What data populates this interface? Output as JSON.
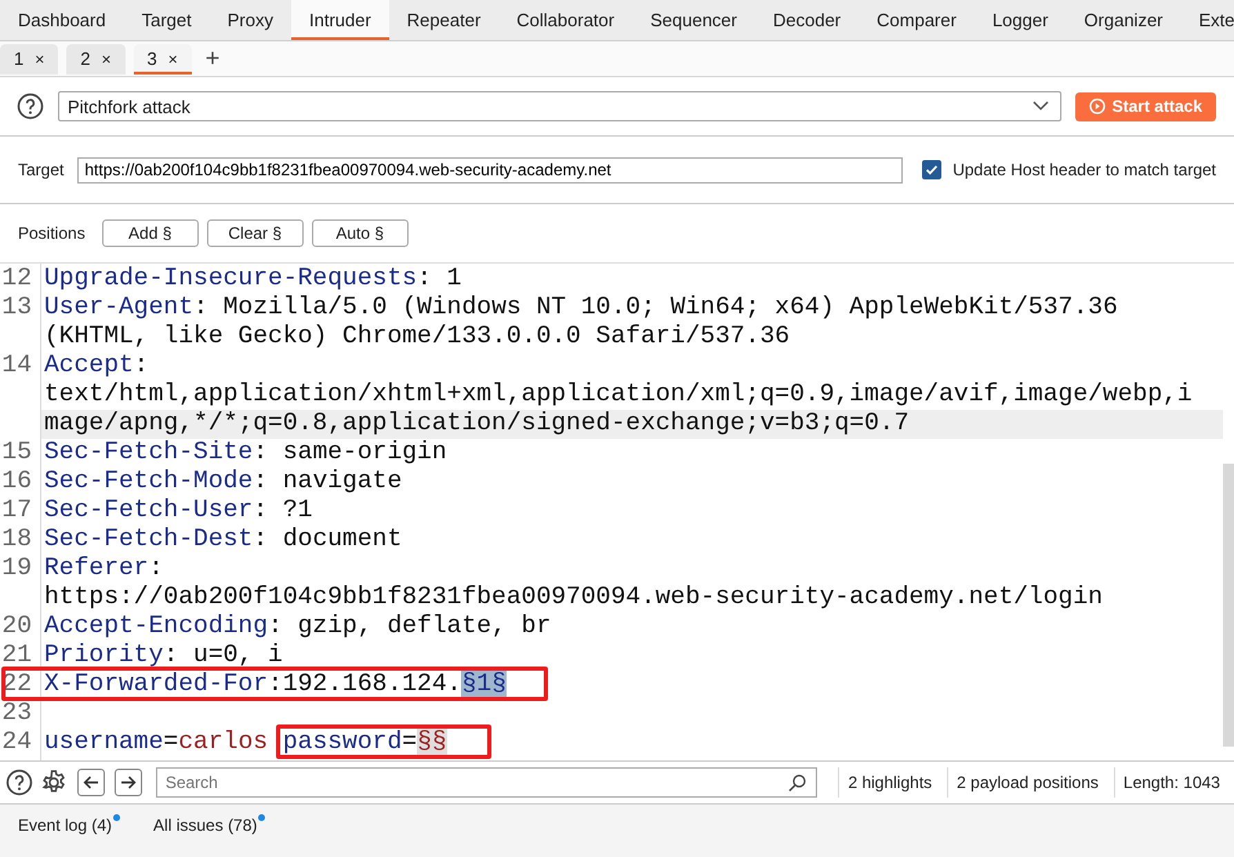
{
  "top_tabs": [
    {
      "label": "Dashboard",
      "selected": false
    },
    {
      "label": "Target",
      "selected": false
    },
    {
      "label": "Proxy",
      "selected": false
    },
    {
      "label": "Intruder",
      "selected": true
    },
    {
      "label": "Repeater",
      "selected": false
    },
    {
      "label": "Collaborator",
      "selected": false
    },
    {
      "label": "Sequencer",
      "selected": false
    },
    {
      "label": "Decoder",
      "selected": false
    },
    {
      "label": "Comparer",
      "selected": false
    },
    {
      "label": "Logger",
      "selected": false
    },
    {
      "label": "Organizer",
      "selected": false
    },
    {
      "label": "Exte",
      "selected": false
    }
  ],
  "attack_tabs": [
    {
      "label": "1",
      "close": "×",
      "selected": false
    },
    {
      "label": "2",
      "close": "×",
      "selected": false
    },
    {
      "label": "3",
      "close": "×",
      "selected": true
    }
  ],
  "new_tab": "+",
  "attack_type": {
    "value": "Pitchfork attack"
  },
  "start_button": "Start attack",
  "target": {
    "label": "Target",
    "value": "https://0ab200f104c9bb1f8231fbea00970094.web-security-academy.net",
    "update_host": {
      "label": "Update Host header to match target",
      "checked": true
    }
  },
  "positions": {
    "label": "Positions",
    "buttons": [
      "Add §",
      "Clear §",
      "Auto §"
    ]
  },
  "editor_rows": [
    {
      "number": "12",
      "highlighted": false,
      "segments": [
        {
          "kind": "key",
          "text": "Upgrade-Insecure-Requests"
        },
        {
          "kind": "plain",
          "text": ": 1"
        }
      ]
    },
    {
      "number": "13",
      "highlighted": false,
      "segments": [
        {
          "kind": "key",
          "text": "User-Agent"
        },
        {
          "kind": "plain",
          "text": ": Mozilla/5.0 (Windows NT 10.0; Win64; x64) AppleWebKit/537.36"
        }
      ]
    },
    {
      "highlighted": false,
      "segments": [
        {
          "kind": "plain",
          "text": "(KHTML, like Gecko) Chrome/133.0.0.0 Safari/537.36"
        }
      ]
    },
    {
      "number": "14",
      "highlighted": false,
      "segments": [
        {
          "kind": "key",
          "text": "Accept"
        },
        {
          "kind": "plain",
          "text": ":"
        }
      ]
    },
    {
      "highlighted": false,
      "segments": [
        {
          "kind": "plain",
          "text": "text/html,application/xhtml+xml,application/xml;q=0.9,image/avif,image/webp,i"
        }
      ]
    },
    {
      "highlighted": true,
      "segments": [
        {
          "kind": "plain",
          "text": "mage/apng,*/*;q=0.8,application/signed-exchange;v=b3;q=0.7"
        }
      ]
    },
    {
      "number": "15",
      "highlighted": false,
      "segments": [
        {
          "kind": "key",
          "text": "Sec-Fetch-Site"
        },
        {
          "kind": "plain",
          "text": ": same-origin"
        }
      ]
    },
    {
      "number": "16",
      "highlighted": false,
      "segments": [
        {
          "kind": "key",
          "text": "Sec-Fetch-Mode"
        },
        {
          "kind": "plain",
          "text": ": navigate"
        }
      ]
    },
    {
      "number": "17",
      "highlighted": false,
      "segments": [
        {
          "kind": "key",
          "text": "Sec-Fetch-User"
        },
        {
          "kind": "plain",
          "text": ": ?1"
        }
      ]
    },
    {
      "number": "18",
      "highlighted": false,
      "segments": [
        {
          "kind": "key",
          "text": "Sec-Fetch-Dest"
        },
        {
          "kind": "plain",
          "text": ": document"
        }
      ]
    },
    {
      "number": "19",
      "highlighted": false,
      "segments": [
        {
          "kind": "key",
          "text": "Referer"
        },
        {
          "kind": "plain",
          "text": ":"
        }
      ]
    },
    {
      "highlighted": false,
      "segments": [
        {
          "kind": "plain",
          "text": "https://0ab200f104c9bb1f8231fbea00970094.web-security-academy.net/login"
        }
      ]
    },
    {
      "number": "20",
      "highlighted": false,
      "segments": [
        {
          "kind": "key",
          "text": "Accept-Encoding"
        },
        {
          "kind": "plain",
          "text": ": gzip, deflate, br"
        }
      ]
    },
    {
      "number": "21",
      "highlighted": false,
      "segments": [
        {
          "kind": "key",
          "text": "Priority"
        },
        {
          "kind": "plain",
          "text": ": u=0, i"
        }
      ]
    },
    {
      "number": "22",
      "highlighted": false,
      "segments": [
        {
          "kind": "key",
          "text": "X-Forwarded-For"
        },
        {
          "kind": "plain",
          "text": ":192.168.124."
        },
        {
          "kind": "payload",
          "text": "§1§"
        }
      ]
    },
    {
      "number": "23",
      "highlighted": false,
      "segments": []
    },
    {
      "number": "24",
      "highlighted": false,
      "segments": [
        {
          "kind": "param",
          "text": "username"
        },
        {
          "kind": "plain",
          "text": "="
        },
        {
          "kind": "param_value",
          "text": "carlos"
        },
        {
          "kind": "param",
          "text": "password"
        },
        {
          "kind": "plain",
          "text": "="
        },
        {
          "kind": "empty_payload",
          "text": "§§"
        }
      ]
    }
  ],
  "annotations": [
    {
      "kind": "box"
    },
    {
      "kind": "box"
    }
  ],
  "search": {
    "placeholder": "Search"
  },
  "status": [
    "2 highlights",
    "2 payload positions",
    "Length: 1043"
  ],
  "bottom_tabs": [
    {
      "label": "Event log (4)",
      "notify": true
    },
    {
      "label": "All issues (78)",
      "notify": true
    }
  ]
}
